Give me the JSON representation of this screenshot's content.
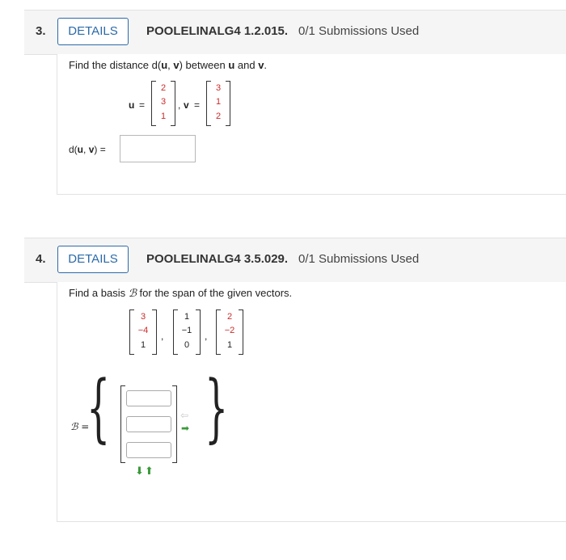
{
  "q3": {
    "number": "3.",
    "details_label": "DETAILS",
    "id": "POOLELINALG4 1.2.015.",
    "submissions": "0/1 Submissions Used",
    "prompt_pre": "Find the distance d(",
    "prompt_u": "u",
    "prompt_comma": ", ",
    "prompt_v": "v",
    "prompt_mid": ") between ",
    "prompt_u2": "u",
    "prompt_and": " and ",
    "prompt_v2": "v",
    "prompt_end": ".",
    "u_label": "u",
    "eq": "=",
    "u_vec": [
      "2",
      "3",
      "1"
    ],
    "comma_sep": ",",
    "v_label": "v",
    "v_vec": [
      "3",
      "1",
      "2"
    ],
    "answer_label_pre": "d(",
    "answer_label_u": "u",
    "answer_label_comma": ", ",
    "answer_label_v": "v",
    "answer_label_post": ") =",
    "answer_value": ""
  },
  "q4": {
    "number": "4.",
    "details_label": "DETAILS",
    "id": "POOLELINALG4 3.5.029.",
    "submissions": "0/1 Submissions Used",
    "prompt_pre": "Find a basis ",
    "prompt_B": "ℬ",
    "prompt_post": " for the span of the given vectors.",
    "vectors": [
      [
        "3",
        "−4",
        "1"
      ],
      [
        "1",
        "−1",
        "0"
      ],
      [
        "2",
        "−2",
        "1"
      ]
    ],
    "comma_sep": ",",
    "basis_label": "ℬ =",
    "left_brace": "{",
    "right_brace": "}",
    "input_values": [
      "",
      "",
      ""
    ],
    "arrow_remove": "⇦",
    "arrow_add": "➡",
    "arrow_down": "⬇",
    "arrow_up": "⬆"
  }
}
